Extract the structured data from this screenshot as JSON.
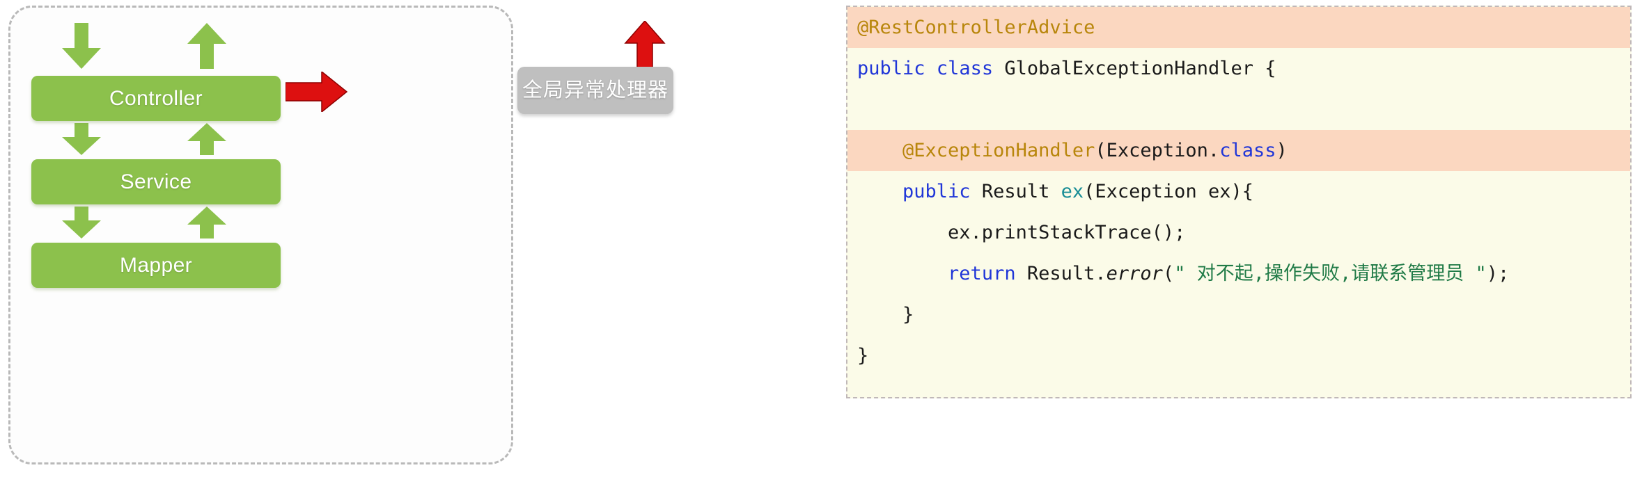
{
  "diagram": {
    "border_style": "dashed",
    "accent_green": "#8cc14c",
    "accent_red": "#dd1010",
    "accent_gray": "#bfbfbf",
    "layers": [
      {
        "id": "controller",
        "label": "Controller"
      },
      {
        "id": "service",
        "label": "Service"
      },
      {
        "id": "mapper",
        "label": "Mapper"
      }
    ],
    "handler_node": {
      "label": "全局异常处理器"
    },
    "arrows": {
      "down_into_controller": "arrow-down-icon",
      "up_out_of_controller": "arrow-up-icon",
      "controller_to_service_down": "arrow-down-icon",
      "service_to_controller_up": "arrow-up-icon",
      "service_to_mapper_down": "arrow-down-icon",
      "mapper_to_service_up": "arrow-up-icon",
      "controller_to_handler_right": "arrow-right-icon",
      "handler_out_up": "arrow-up-icon"
    }
  },
  "code": {
    "language": "java",
    "background": "#fbfbe8",
    "highlight_background": "#fbd7c0",
    "lines": [
      {
        "n": 1,
        "highlight": true,
        "tokens": [
          {
            "t": "@RestControllerAdvice",
            "c": "ann"
          }
        ]
      },
      {
        "n": 2,
        "highlight": false,
        "tokens": [
          {
            "t": "public",
            "c": "kw"
          },
          {
            "t": " ",
            "c": "plain"
          },
          {
            "t": "class",
            "c": "kw"
          },
          {
            "t": " ",
            "c": "plain"
          },
          {
            "t": "GlobalExceptionHandler",
            "c": "type"
          },
          {
            "t": " {",
            "c": "plain"
          }
        ]
      },
      {
        "n": 3,
        "highlight": false,
        "tokens": [
          {
            "t": "",
            "c": "plain"
          }
        ]
      },
      {
        "n": 4,
        "highlight": true,
        "tokens": [
          {
            "t": "    ",
            "c": "plain"
          },
          {
            "t": "@ExceptionHandler",
            "c": "ann"
          },
          {
            "t": "(Exception.",
            "c": "plain"
          },
          {
            "t": "class",
            "c": "kw"
          },
          {
            "t": ")",
            "c": "plain"
          }
        ]
      },
      {
        "n": 5,
        "highlight": false,
        "tokens": [
          {
            "t": "    ",
            "c": "plain"
          },
          {
            "t": "public",
            "c": "kw"
          },
          {
            "t": " Result ",
            "c": "type"
          },
          {
            "t": "ex",
            "c": "method"
          },
          {
            "t": "(Exception ex){",
            "c": "plain"
          }
        ]
      },
      {
        "n": 6,
        "highlight": false,
        "tokens": [
          {
            "t": "        ex.printStackTrace();",
            "c": "plain"
          }
        ]
      },
      {
        "n": 7,
        "highlight": false,
        "tokens": [
          {
            "t": "        ",
            "c": "plain"
          },
          {
            "t": "return",
            "c": "kw"
          },
          {
            "t": " Result.",
            "c": "plain"
          },
          {
            "t": "error",
            "c": "it"
          },
          {
            "t": "(",
            "c": "plain"
          },
          {
            "t": "\" 对不起,操作失败,请联系管理员 \"",
            "c": "str"
          },
          {
            "t": ");",
            "c": "plain"
          }
        ]
      },
      {
        "n": 8,
        "highlight": false,
        "tokens": [
          {
            "t": "    }",
            "c": "plain"
          }
        ]
      },
      {
        "n": 9,
        "highlight": false,
        "tokens": [
          {
            "t": "}",
            "c": "plain"
          }
        ]
      }
    ]
  }
}
